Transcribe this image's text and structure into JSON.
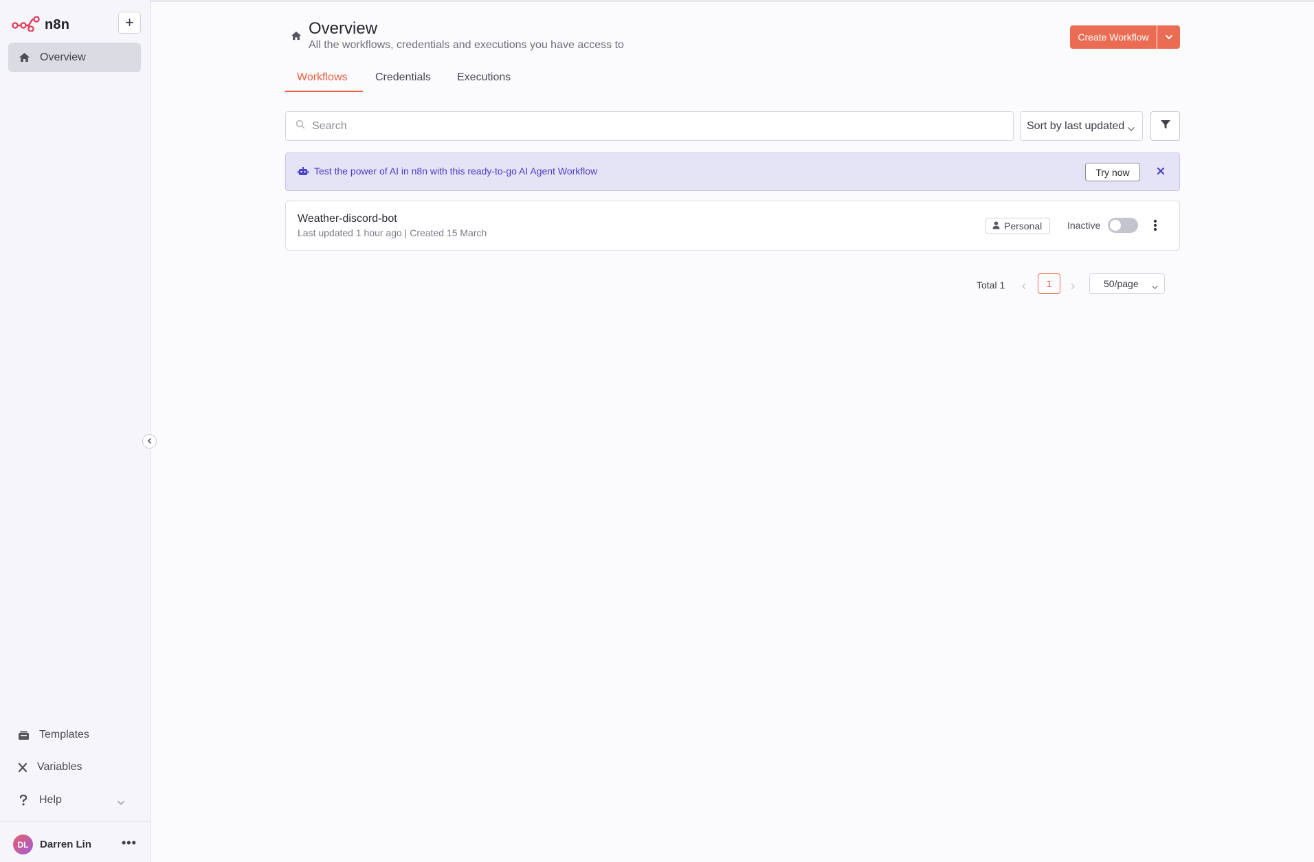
{
  "app": {
    "name": "n8n",
    "accent_color": "#ea6d53"
  },
  "sidebar": {
    "add_button_label": "+",
    "items": [
      {
        "label": "Overview",
        "icon": "home-icon",
        "active": true
      }
    ],
    "bottom_items": [
      {
        "label": "Templates",
        "icon": "templates-icon"
      },
      {
        "label": "Variables",
        "icon": "variables-icon"
      },
      {
        "label": "Help",
        "icon": "help-icon"
      }
    ],
    "user": {
      "initials": "DL",
      "name": "Darren Lin",
      "menu_label": "•••"
    }
  },
  "header": {
    "title": "Overview",
    "subtitle": "All the workflows, credentials and executions you have access to",
    "create_button_label": "Create Workflow"
  },
  "tabs": [
    {
      "label": "Workflows",
      "active": true
    },
    {
      "label": "Credentials",
      "active": false
    },
    {
      "label": "Executions",
      "active": false
    }
  ],
  "toolbar": {
    "search_placeholder": "Search",
    "search_value": "",
    "sort_label": "Sort by last updated"
  },
  "banner": {
    "text": "Test the power of AI in n8n with this ready-to-go AI Agent Workflow",
    "button_label": "Try now",
    "background": "#e5e3f6",
    "text_color": "#4a3ec1"
  },
  "workflows": [
    {
      "name": "Weather-discord-bot",
      "meta": "Last updated 1 hour ago | Created 15 March",
      "owner_badge": "Personal",
      "status": "Inactive",
      "active": false
    }
  ],
  "pagination": {
    "total_label": "Total 1",
    "current_page": "1",
    "per_page": "50/page"
  }
}
